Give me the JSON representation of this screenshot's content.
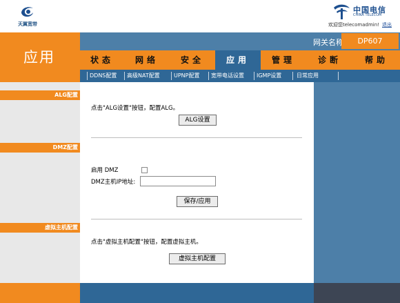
{
  "header": {
    "left_brand": "天翼宽带",
    "right_brand_cn": "中国电信",
    "right_brand_en": "CHINA TELECOM",
    "welcome_text": "欢迎您telecomadmin!",
    "logout_label": "退出"
  },
  "page": {
    "title": "应用",
    "gateway_label": "网关名称",
    "gateway_value": "DP607"
  },
  "nav": {
    "items": [
      "状态",
      "网络",
      "安全",
      "应用",
      "管理",
      "诊断",
      "帮助"
    ],
    "active": "应用"
  },
  "subnav": {
    "items": [
      "DDNS配置",
      "高级NAT配置",
      "UPNP配置",
      "宽带电话设置",
      "IGMP设置",
      "日常应用"
    ]
  },
  "sidebar": {
    "alg_label": "ALG配置",
    "dmz_label": "DMZ配置",
    "vhost_label": "虚拟主机配置"
  },
  "alg": {
    "hint": "点击\"ALG设置\"按钮，配置ALG。",
    "button_label": "ALG设置"
  },
  "dmz": {
    "enable_label": "启用 DMZ",
    "enabled": false,
    "ip_label": "DMZ主机IP地址:",
    "ip_value": "",
    "save_label": "保存/应用"
  },
  "vhost": {
    "hint": "点击\"虚拟主机配置\"按钮，配置虚拟主机。",
    "button_label": "虚拟主机配置"
  },
  "colors": {
    "orange": "#f18a1f",
    "blue": "#4d7fa8",
    "dark_blue": "#2f6796"
  }
}
